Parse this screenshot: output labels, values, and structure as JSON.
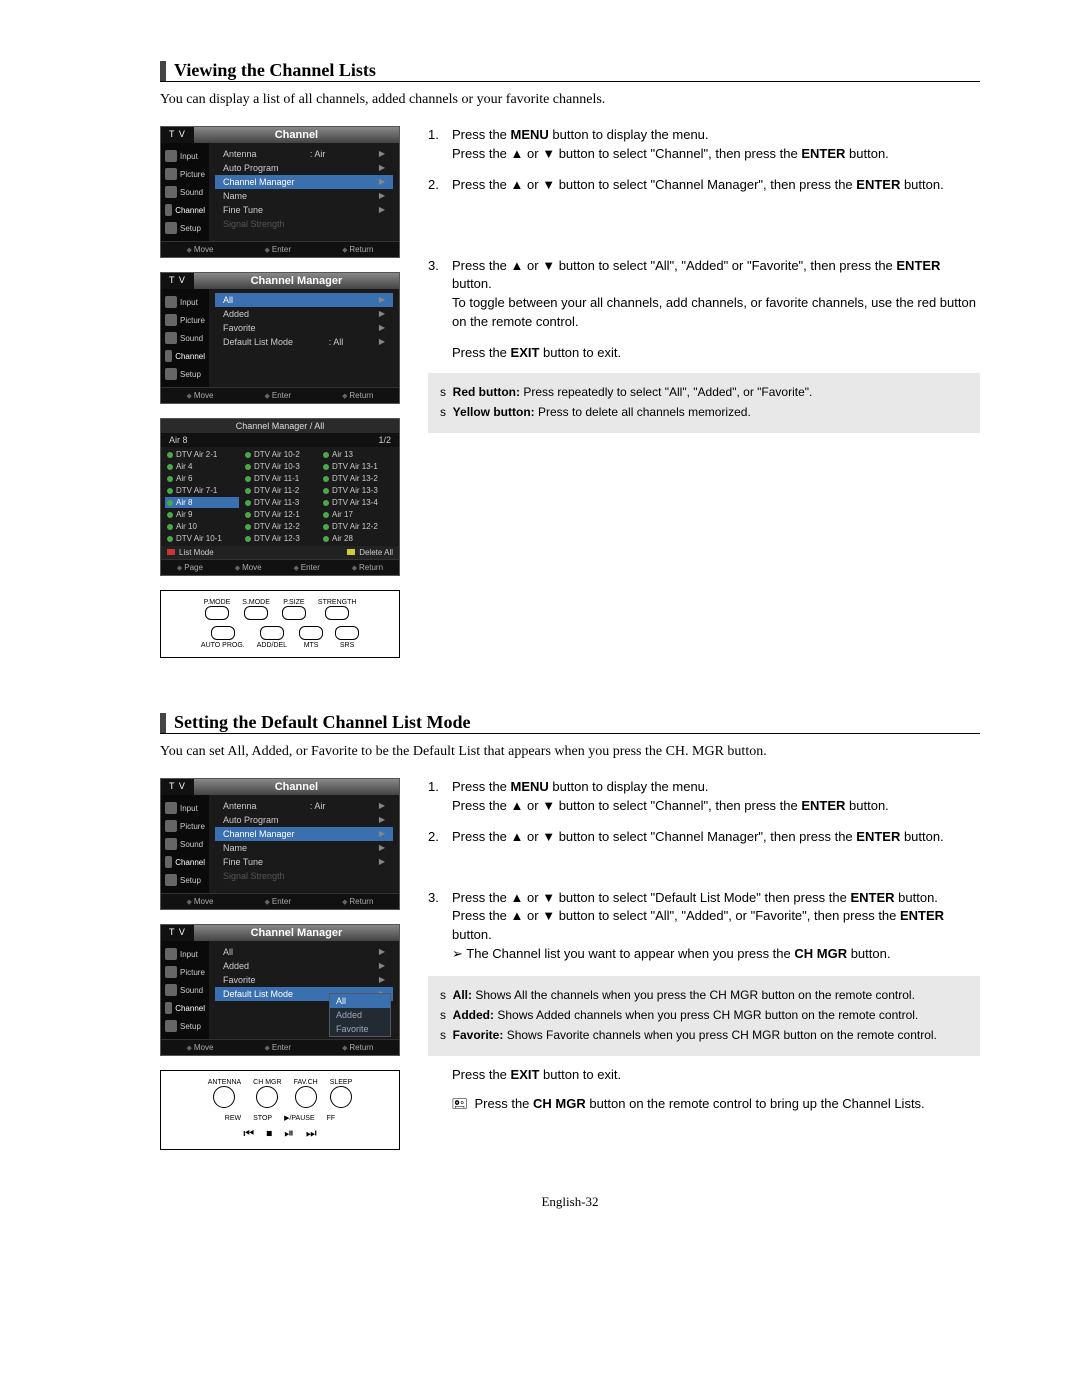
{
  "section1": {
    "title": "Viewing the Channel Lists",
    "intro": "You can display a list of all channels, added channels or your favorite channels.",
    "steps": {
      "1a": "Press the ",
      "1b": " button to display the menu.",
      "1c": "Press the ",
      "1d": " or ",
      "1e": " button to select \"Channel\", then press the ",
      "1f": " button.",
      "2a": "Press the ",
      "2b": " or ",
      "2c": " button to select \"Channel Manager\", then press the ",
      "2d": " button.",
      "3a": "Press the ",
      "3b": " or ",
      "3c": " button to select \"All\", \"Added\" or \"Favorite\", then press the ",
      "3d": " button.",
      "3e": "To toggle between your all channels, add channels, or favorite channels, use the red button on the remote control.",
      "exit": "Press the ",
      "exit_btn": "EXIT",
      "exit2": " button to exit."
    },
    "note_red_lead": "Red button: ",
    "note_red": "Press repeatedly to select \"All\", \"Added\", or \"Favorite\".",
    "note_yellow_lead": "Yellow button: ",
    "note_yellow": "Press to delete all channels memorized."
  },
  "section2": {
    "title": "Setting the Default Channel List Mode",
    "intro": "You can set All, Added, or Favorite to be the Default List that appears when you press the CH. MGR button.",
    "steps": {
      "1a": "Press the ",
      "1b": " button to display the menu.",
      "1c": "Press the ",
      "1d": " or ",
      "1e": " button to select \"Channel\", then press the ",
      "1f": " button.",
      "2a": "Press the ",
      "2b": " or ",
      "2c": " button to select \"Channel Manager\", then press the ",
      "2d": " button.",
      "3a": "Press the ",
      "3b": " or ",
      "3c": " button to select \"Default List Mode\" then press the ",
      "3d": " button.",
      "3e": "Press the ",
      "3f": " or ",
      "3g": " button to select \"All\", \"Added\", or \"Favorite\", then press the ",
      "3h": " button.",
      "tip_lead": "➢ ",
      "tip": "The Channel list you want to appear when you press the ",
      "tip_btn": "CH MGR",
      "tip2": " button.",
      "exit": "Press the ",
      "exit_btn": "EXIT",
      "exit2": " button to exit.",
      "chmgr_a": "Press the ",
      "chmgr_b": "CH MGR",
      "chmgr_c": " button on the remote control to bring up the Channel Lists."
    },
    "note_all_lead": "All: ",
    "note_all": "Shows All the channels when you press the CH MGR button on the remote control.",
    "note_added_lead": "Added: ",
    "note_added": "Shows Added channels when you press CH MGR button on the remote control.",
    "note_fav_lead": "Favorite: ",
    "note_fav": "Shows Favorite channels when you press CH MGR button on the remote control."
  },
  "kw": {
    "menu": "MENU",
    "enter": "ENTER"
  },
  "osd": {
    "tv": "T V",
    "title_channel": "Channel",
    "title_chmgr": "Channel Manager",
    "side": [
      "Input",
      "Picture",
      "Sound",
      "Channel",
      "Setup"
    ],
    "menu1": {
      "antenna_l": "Antenna",
      "antenna_v": ": Air",
      "auto": "Auto Program",
      "chmgr": "Channel Manager",
      "name": "Name",
      "fine": "Fine Tune",
      "signal": "Signal Strength"
    },
    "menu2": {
      "all": "All",
      "added": "Added",
      "fav": "Favorite",
      "dlm_l": "Default List Mode",
      "dlm_v": ": All"
    },
    "footer": {
      "move": "Move",
      "enter": "Enter",
      "return": "Return",
      "page": "Page"
    },
    "chlist": {
      "title": "Channel Manager / All",
      "current": "Air 8",
      "page": "1/2",
      "col1": [
        "DTV Air 2-1",
        "Air 4",
        "Air 6",
        "DTV Air 7-1",
        "Air 8",
        "Air 9",
        "Air 10",
        "DTV Air 10-1"
      ],
      "col2": [
        "DTV Air 10-2",
        "DTV Air 10-3",
        "DTV Air 11-1",
        "DTV Air 11-2",
        "DTV Air 11-3",
        "DTV Air 12-1",
        "DTV Air 12-2",
        "DTV Air 12-3"
      ],
      "col3": [
        "Air 13",
        "DTV Air 13-1",
        "DTV Air 13-2",
        "DTV Air 13-3",
        "DTV Air 13-4",
        "Air 17",
        "DTV Air 12-2",
        "Air 28"
      ],
      "list_mode": "List Mode",
      "delete_all": "Delete All"
    },
    "dropdown": [
      "All",
      "Added",
      "Favorite"
    ]
  },
  "remote1": {
    "row1": [
      "P.MODE",
      "S.MODE",
      "P.SIZE",
      "STRENGTH"
    ],
    "row2": [
      "AUTO PROG.",
      "ADD/DEL",
      "MTS",
      "SRS"
    ]
  },
  "remote2": {
    "row1": [
      "ANTENNA",
      "CH MGR",
      "FAV.CH",
      "SLEEP"
    ],
    "row2": [
      "REW",
      "STOP",
      "▶/PAUSE",
      "FF"
    ]
  },
  "page_num": "English-32"
}
